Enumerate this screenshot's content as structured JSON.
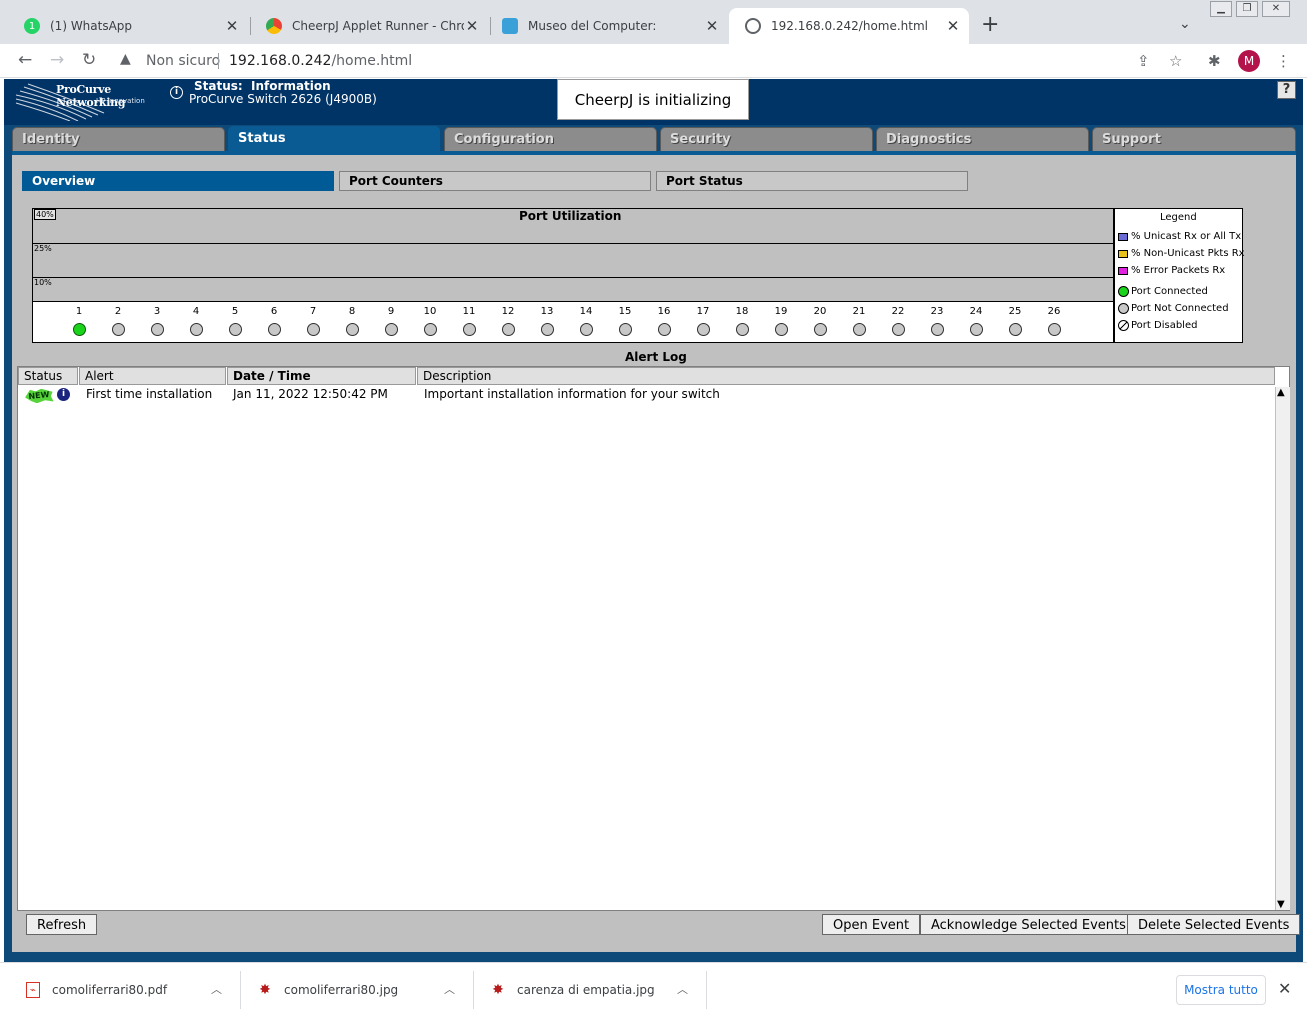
{
  "browser": {
    "tabs": [
      {
        "title": "(1) WhatsApp",
        "favicon": "whatsapp-icon",
        "badge": "1"
      },
      {
        "title": "CheerpJ Applet Runner - Chrome W",
        "favicon": "chrome-webstore-icon"
      },
      {
        "title": "Museo del Computer:",
        "favicon": "cube-icon"
      },
      {
        "title": "192.168.0.242/home.html",
        "favicon": "globe-icon"
      }
    ],
    "not_secure": "Non sicuro",
    "url_host": "192.168.0.242",
    "url_path": "/home.html",
    "profile_initial": "M"
  },
  "header": {
    "logo_name": "ProCurve Networking",
    "logo_sub": "HP Innovation",
    "status_line": "Status:  Information",
    "model_line": "ProCurve Switch 2626 (J4900B)",
    "cheerpj_notice": "CheerpJ is initializing",
    "help_label": "?"
  },
  "main_tabs": [
    {
      "label": "Identity"
    },
    {
      "label": "Status"
    },
    {
      "label": "Configuration"
    },
    {
      "label": "Security"
    },
    {
      "label": "Diagnostics"
    },
    {
      "label": "Support"
    }
  ],
  "sub_tabs": [
    {
      "label": "Overview"
    },
    {
      "label": "Port Counters"
    },
    {
      "label": "Port Status"
    }
  ],
  "port_utilization": {
    "title": "Port Utilization",
    "scale_labels": [
      "40%",
      "25%",
      "10%"
    ],
    "ports": [
      "1",
      "2",
      "3",
      "4",
      "5",
      "6",
      "7",
      "8",
      "9",
      "10",
      "11",
      "12",
      "13",
      "14",
      "15",
      "16",
      "17",
      "18",
      "19",
      "20",
      "21",
      "22",
      "23",
      "24",
      "25",
      "26"
    ],
    "connected_ports": [
      "1"
    ]
  },
  "legend": {
    "title": "Legend",
    "items": [
      {
        "label": "% Unicast Rx or All Tx",
        "color": "#6b6bd6"
      },
      {
        "label": "% Non-Unicast Pkts Rx",
        "color": "#e8c21c"
      },
      {
        "label": "% Error Packets Rx",
        "color": "#e022e0"
      },
      {
        "label": "Port Connected",
        "color": "#1bd31b"
      },
      {
        "label": "Port Not Connected",
        "color": "#c8c8c8"
      },
      {
        "label": "Port Disabled",
        "color": "#c8c8c8"
      }
    ]
  },
  "alert_log": {
    "title": "Alert Log",
    "columns": [
      "Status",
      "Alert",
      "Date / Time",
      "Description"
    ],
    "rows": [
      {
        "badge": "NEW",
        "alert": "First time installation",
        "datetime": "Jan 11, 2022 12:50:42 PM",
        "description": "Important installation information for your switch"
      }
    ]
  },
  "buttons": {
    "refresh": "Refresh",
    "open_event": "Open Event",
    "acknowledge": "Acknowledge Selected Events",
    "delete": "Delete Selected Events"
  },
  "downloads": {
    "items": [
      {
        "name": "comoliferrari80.pdf",
        "icon": "pdf-icon"
      },
      {
        "name": "comoliferrari80.jpg",
        "icon": "image-file-icon"
      },
      {
        "name": "carenza di empatia.jpg",
        "icon": "image-file-icon"
      }
    ],
    "show_all": "Mostra tutto"
  }
}
